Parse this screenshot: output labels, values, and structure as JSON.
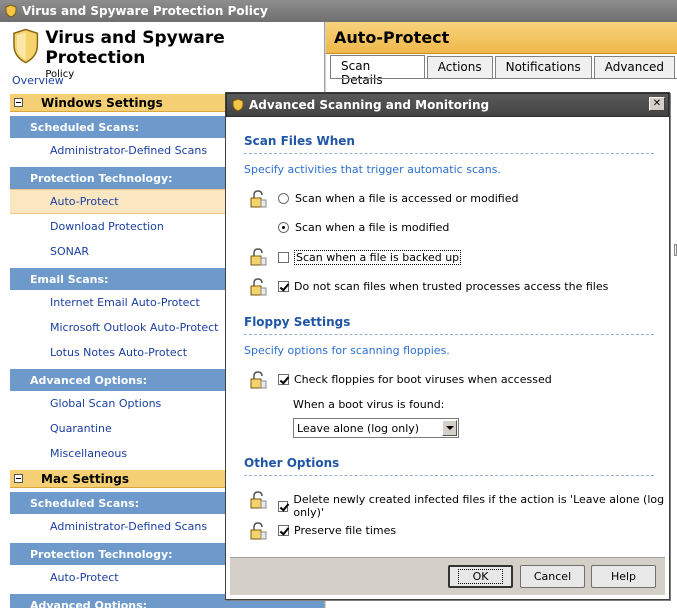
{
  "window": {
    "title": "Virus and Spyware Protection Policy"
  },
  "brand": {
    "title": "Virus and Spyware Protection",
    "subtitle": "Policy"
  },
  "nav": {
    "overview": "Overview",
    "windows": {
      "header": "Windows Settings",
      "cats": [
        {
          "label": "Scheduled Scans:",
          "items": [
            "Administrator-Defined Scans"
          ]
        },
        {
          "label": "Protection Technology:",
          "items": [
            "Auto-Protect",
            "Download Protection",
            "SONAR"
          ]
        },
        {
          "label": "Email Scans:",
          "items": [
            "Internet Email Auto-Protect",
            "Microsoft Outlook Auto-Protect",
            "Lotus Notes Auto-Protect"
          ]
        },
        {
          "label": "Advanced Options:",
          "items": [
            "Global Scan Options",
            "Quarantine",
            "Miscellaneous"
          ]
        }
      ]
    },
    "mac": {
      "header": "Mac Settings",
      "cats": [
        {
          "label": "Scheduled Scans:",
          "items": [
            "Administrator-Defined Scans"
          ]
        },
        {
          "label": "Protection Technology:",
          "items": [
            "Auto-Protect"
          ]
        },
        {
          "label": "Advanced Options:",
          "items": []
        }
      ]
    }
  },
  "right": {
    "title": "Auto-Protect",
    "tabs": [
      "Scan Details",
      "Actions",
      "Notifications",
      "Advanced"
    ]
  },
  "dialog": {
    "title": "Advanced Scanning and Monitoring",
    "scan_files": {
      "heading": "Scan Files When",
      "desc": "Specify activities that trigger automatic scans.",
      "opt_accessed": "Scan when a file is accessed or modified",
      "opt_modified": "Scan when a file is modified",
      "opt_backed_up": "Scan when a file is backed up",
      "opt_trusted": "Do not scan files when trusted processes access the files"
    },
    "floppy": {
      "heading": "Floppy Settings",
      "desc": "Specify options for scanning floppies.",
      "check_boot": "Check floppies for boot viruses when accessed",
      "when_found": "When a boot virus is found:",
      "selected": "Leave alone (log only)"
    },
    "other": {
      "heading": "Other Options",
      "delete_new": "Delete newly created infected files if the action is 'Leave alone (log only)'",
      "preserve": "Preserve file times"
    },
    "buttons": {
      "ok": "OK",
      "cancel": "Cancel",
      "help": "Help"
    }
  },
  "colors": {
    "accent_orange": "#f0b84b",
    "nav_blue": "#6d9acb",
    "link_blue": "#1a3f9e",
    "section_blue": "#1f56a6"
  }
}
